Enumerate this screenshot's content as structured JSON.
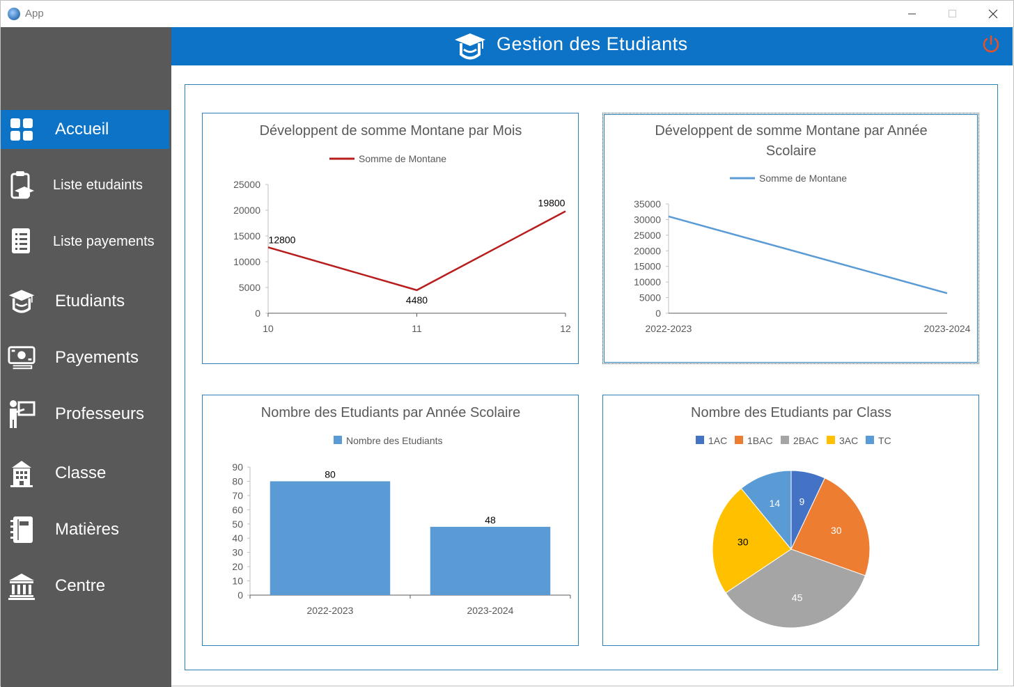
{
  "window": {
    "title": "App"
  },
  "header": {
    "title": "Gestion des Etudiants"
  },
  "sidebar": {
    "items": [
      {
        "label": "Accueil",
        "icon": "grid-icon",
        "active": true
      },
      {
        "label": "Liste etudaints",
        "icon": "clipboard-icon",
        "active": false
      },
      {
        "label": "Liste payements",
        "icon": "list-document-icon",
        "active": false
      },
      {
        "label": "Etudiants",
        "icon": "graduate-icon",
        "active": false
      },
      {
        "label": "Payements",
        "icon": "money-icon",
        "active": false
      },
      {
        "label": "Professeurs",
        "icon": "teacher-icon",
        "active": false
      },
      {
        "label": "Classe",
        "icon": "building-icon",
        "active": false
      },
      {
        "label": "Matières",
        "icon": "notebook-icon",
        "active": false
      },
      {
        "label": "Centre",
        "icon": "bank-icon",
        "active": false
      }
    ]
  },
  "colors": {
    "accent": "#0d73c6",
    "sidebar": "#595959",
    "power": "#e8502a"
  },
  "chart_data": [
    {
      "type": "line",
      "title": "Développent de somme  Montane par Mois",
      "legend": "Somme de Montane",
      "legend_position": "top",
      "color": "#b81c1c",
      "x": [
        "10",
        "11",
        "12"
      ],
      "series": [
        {
          "name": "Somme de Montane",
          "values": [
            12800,
            4480,
            19800
          ]
        }
      ],
      "data_labels": [
        "12800",
        "4480",
        "19800"
      ],
      "ylim": [
        0,
        25000
      ],
      "yticks": [
        "0",
        "5000",
        "10000",
        "15000",
        "20000",
        "25000"
      ]
    },
    {
      "type": "line",
      "title": "Développent de somme  Montane par Année Scolaire",
      "title_lines": [
        "Développent de somme  Montane par Année",
        "Scolaire"
      ],
      "legend": "Somme de Montane",
      "legend_position": "top",
      "color": "#5b9bd5",
      "x": [
        "2022-2023",
        "2023-2024"
      ],
      "series": [
        {
          "name": "Somme de Montane",
          "values": [
            31000,
            6400
          ]
        }
      ],
      "ylim": [
        0,
        35000
      ],
      "yticks": [
        "0",
        "5000",
        "10000",
        "15000",
        "20000",
        "25000",
        "30000",
        "35000"
      ]
    },
    {
      "type": "bar",
      "title": "Nombre des Etudiants par Année Scolaire",
      "legend": "Nombre des Etudiants",
      "legend_position": "top",
      "color": "#5b9bd5",
      "categories": [
        "2022-2023",
        "2023-2024"
      ],
      "series": [
        {
          "name": "Nombre des Etudiants",
          "values": [
            80,
            48
          ]
        }
      ],
      "data_labels": [
        "80",
        "48"
      ],
      "ylim": [
        0,
        90
      ],
      "yticks": [
        "0",
        "10",
        "20",
        "30",
        "40",
        "50",
        "60",
        "70",
        "80",
        "90"
      ]
    },
    {
      "type": "pie",
      "title": "Nombre des Etudiants par Class",
      "legend_position": "top",
      "categories": [
        "1AC",
        "1BAC",
        "2BAC",
        "3AC",
        "TC"
      ],
      "values": [
        9,
        30,
        45,
        30,
        14
      ],
      "data_labels": [
        "9",
        "30",
        "45",
        "30",
        "14"
      ],
      "colors": [
        "#4472c4",
        "#ed7d31",
        "#a5a5a5",
        "#ffc000",
        "#5b9bd5"
      ]
    }
  ]
}
